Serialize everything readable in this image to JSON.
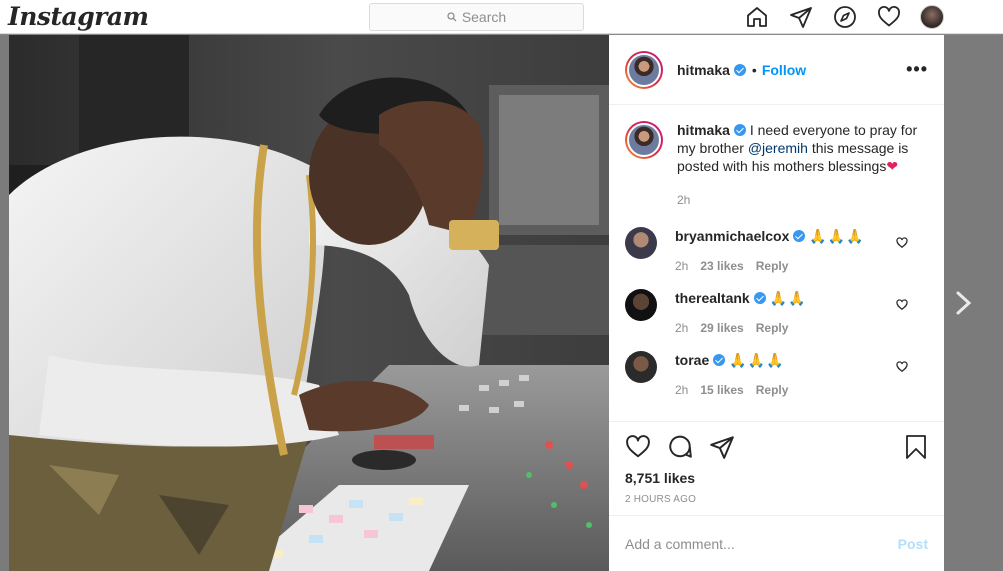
{
  "nav": {
    "logo": "Instagram",
    "search_placeholder": "Search",
    "icons": [
      "home-icon",
      "direct-icon",
      "explore-icon",
      "activity-heart-icon",
      "profile-avatar"
    ]
  },
  "post": {
    "author": "hitmaka",
    "follow_label": "Follow",
    "dot": "•",
    "more": "•••",
    "caption": {
      "user": "hitmaka",
      "text_before": "I need everyone to pray for my brother ",
      "mention": "@jeremih",
      "text_after": " this message is posted with his mothers blessings",
      "emoji": "❤",
      "time": "2h"
    },
    "comments": [
      {
        "user": "bryanmichaelcox",
        "text": "🙏🙏🙏",
        "time": "2h",
        "likes": "23 likes",
        "reply": "Reply"
      },
      {
        "user": "therealtank",
        "text": "🙏🙏",
        "time": "2h",
        "likes": "29 likes",
        "reply": "Reply"
      },
      {
        "user": "torae",
        "text": "🙏🙏🙏",
        "time": "2h",
        "likes": "15 likes",
        "reply": "Reply"
      }
    ],
    "likes": "8,751 likes",
    "posted_ago": "2 HOURS AGO",
    "add_comment_placeholder": "Add a comment...",
    "post_label": "Post"
  },
  "colors": {
    "link_blue": "#0095f6",
    "verified_blue": "#3897f0",
    "post_disabled": "#b2dffc"
  }
}
